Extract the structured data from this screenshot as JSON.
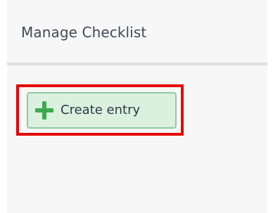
{
  "panel": {
    "title": "Manage Checklist"
  },
  "toolbar": {
    "create_label": "Create entry",
    "create_icon": "plus-icon"
  },
  "colors": {
    "highlight": "#e60000",
    "button_bg": "#dbf0df",
    "button_border": "#93c9a0",
    "plus": "#3ea84f"
  }
}
